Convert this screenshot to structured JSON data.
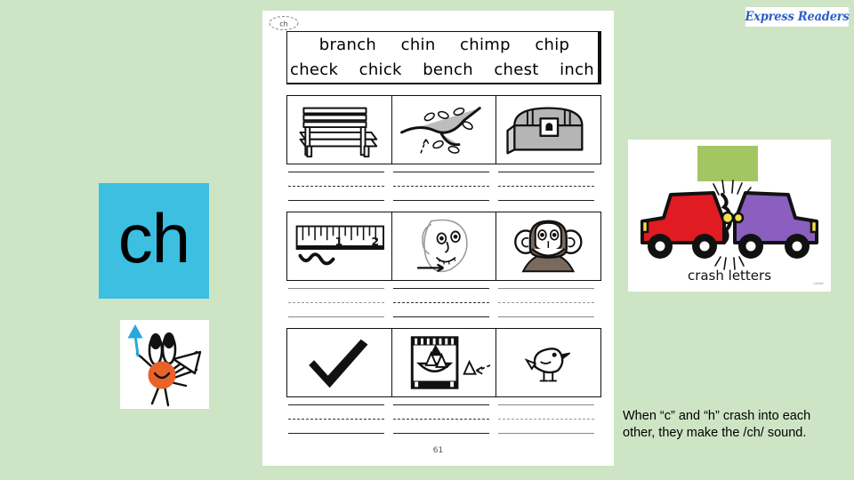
{
  "slide": {
    "background_color": "#cde5c4",
    "logo": {
      "text": "Express Readers",
      "color": "#2b5fc4"
    }
  },
  "focus_tile": {
    "letters": "ch",
    "background_color": "#3cbfe0",
    "text_color": "#000000"
  },
  "mascot": {
    "label": "bug-mascot-drawing",
    "face_color": "#e8622a",
    "arrow_color": "#29a8dc"
  },
  "worksheet": {
    "badge_label": "ch",
    "page_number": "61",
    "word_list": {
      "row1": [
        "branch",
        "chin",
        "chimp",
        "chip"
      ],
      "row2": [
        "check",
        "chick",
        "bench",
        "chest",
        "inch"
      ]
    },
    "picture_rows": [
      {
        "cells": [
          {
            "icon": "bench-icon",
            "answer": "bench"
          },
          {
            "icon": "branch-icon",
            "answer": "branch"
          },
          {
            "icon": "chest-icon",
            "answer": "chest"
          }
        ]
      },
      {
        "cells": [
          {
            "icon": "inch-ruler-icon",
            "answer": "inch"
          },
          {
            "icon": "chin-face-icon",
            "answer": "chin"
          },
          {
            "icon": "chimp-icon",
            "answer": "chimp"
          }
        ]
      },
      {
        "cells": [
          {
            "icon": "check-mark-icon",
            "answer": "check"
          },
          {
            "icon": "chips-bag-icon",
            "answer": "chips"
          },
          {
            "icon": "chick-icon",
            "answer": "chick"
          }
        ]
      }
    ]
  },
  "crash_image": {
    "title": "crash letters",
    "left_car_color": "#e01b22",
    "right_car_color": "#8a5fbf",
    "banner_color": "#a3c663",
    "signature": ""
  },
  "caption": {
    "text": "When “c” and “h” crash into each other, they make the /ch/ sound."
  }
}
